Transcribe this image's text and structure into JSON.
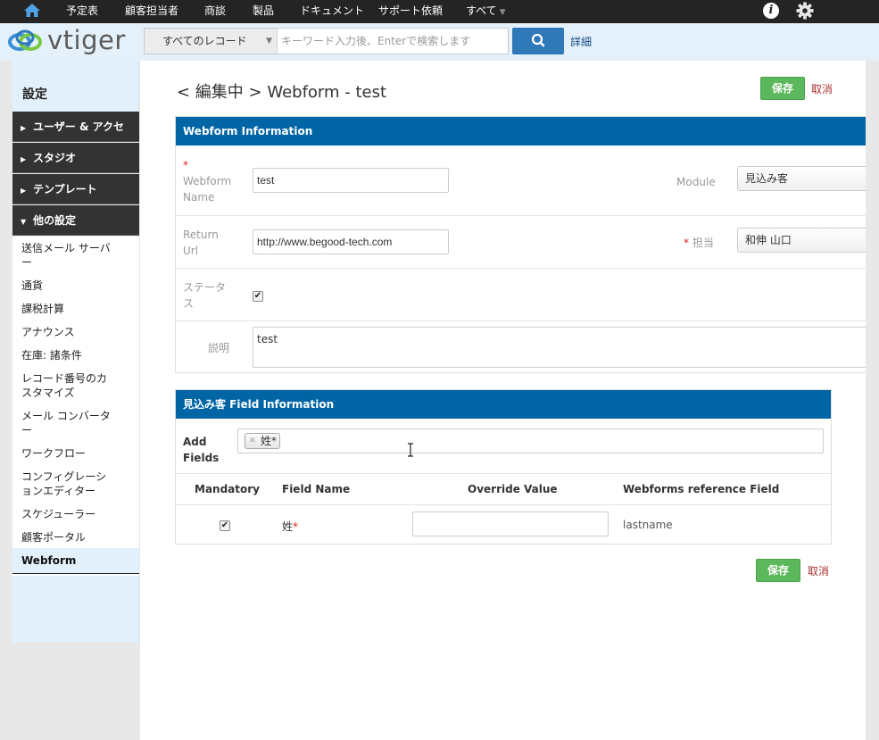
{
  "topbar": {
    "menu": [
      "予定表",
      "顧客担当者",
      "商談",
      "製品",
      "ドキュメント",
      "サポート依頼",
      "すべて"
    ]
  },
  "header": {
    "logo_text": "vtiger",
    "search_scope": "すべてのレコード",
    "search_placeholder": "キーワード入力後、Enterで検索します",
    "advanced_label": "詳細"
  },
  "sidebar": {
    "title": "設定",
    "sections": [
      "ユーザー & アクセ",
      "スタジオ",
      "テンプレート",
      "他の設定"
    ],
    "items": [
      "送信メール サーバー",
      "通貨",
      "課税計算",
      "アナウンス",
      "在庫: 諸条件",
      "レコード番号のカスタマイズ",
      "メール コンバーター",
      "ワークフロー",
      "コンフィグレーションエディター",
      "スケジューラー",
      "顧客ポータル"
    ],
    "active_item": "Webform"
  },
  "page": {
    "title": "< 編集中 > Webform - test",
    "save_label": "保存",
    "cancel_label": "取消"
  },
  "webform_info": {
    "heading": "Webform Information",
    "name_label": "Webform Name",
    "name_value": "test",
    "module_label": "Module",
    "module_value": "見込み客",
    "return_url_label": "Return Url",
    "return_url_value": "http://www.begood-tech.com",
    "owner_label": "担当",
    "owner_value": "和伸 山口",
    "status_label": "ステータス",
    "status_checked": true,
    "description_label": "説明",
    "description_value": "test"
  },
  "field_info": {
    "heading": "見込み客 Field Information",
    "add_fields_label": "Add Fields",
    "selected_tag": "姓*",
    "columns": [
      "Mandatory",
      "Field Name",
      "Override Value",
      "Webforms reference Field"
    ],
    "rows": [
      {
        "mandatory": true,
        "field_name": "姓",
        "override_value": "",
        "reference_field": "lastname"
      }
    ]
  },
  "colors": {
    "topbar": "#242424",
    "header": "#e4f1fb",
    "panel_head": "#0065a5",
    "save": "#5cb85c",
    "search_button": "#2f79b9"
  }
}
